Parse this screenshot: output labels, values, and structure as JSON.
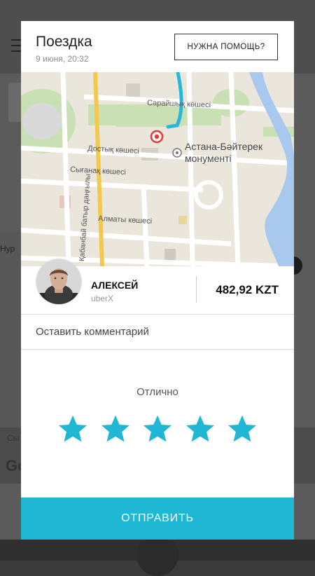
{
  "modal": {
    "title": "Поездка",
    "subtitle": "9 июня, 20:32",
    "help_button": "НУЖНА ПОМОЩЬ?"
  },
  "map": {
    "street_labels": {
      "saraishyk": "Сарайшық көшесі",
      "dostyk": "Достық көшесі",
      "syganak": "Сығанақ көшесі",
      "kabanbai": "Қабанбай батыр даңғылы",
      "almaty": "Алматы көшесі"
    },
    "landmark_line1": "Астана-Бәйтерек",
    "landmark_line2": "монументі",
    "route_color": "#29b6d8",
    "pin_color": "#e53935",
    "background_color": "#ece7dc"
  },
  "driver": {
    "name": "АЛЕКСЕЙ",
    "car_type": "uberX",
    "fare": "482,92 KZT"
  },
  "comment": {
    "placeholder": "Оставить комментарий"
  },
  "rating": {
    "label": "Отлично",
    "stars": 5,
    "max_stars": 5,
    "star_color": "#1fb7d3"
  },
  "submit_button": "ОТПРАВИТЬ",
  "background": {
    "road_fragment": "Нур",
    "map_fragment": "Сы",
    "google_fragment": "Go"
  }
}
